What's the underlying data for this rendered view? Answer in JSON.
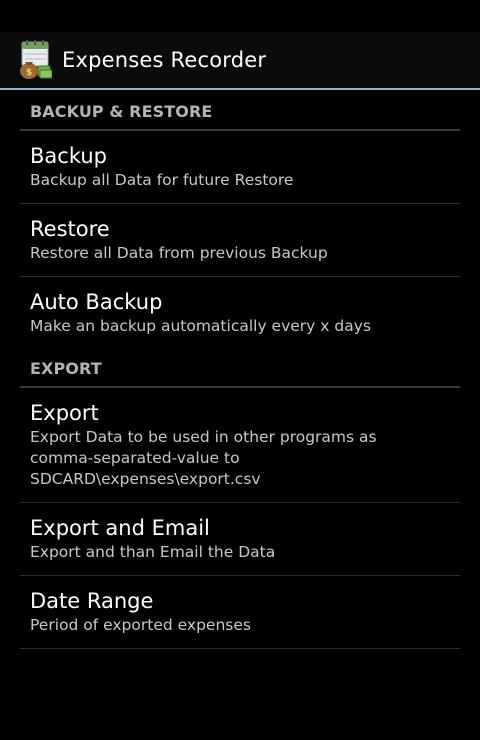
{
  "action_bar": {
    "title": "Expenses Recorder",
    "icon": "expenses-app-icon"
  },
  "sections": [
    {
      "header": "BACKUP & RESTORE",
      "items": [
        {
          "title": "Backup",
          "summary": "Backup all Data for future Restore"
        },
        {
          "title": "Restore",
          "summary": "Restore all Data from previous Backup"
        },
        {
          "title": "Auto Backup",
          "summary": "Make an backup automatically every x days"
        }
      ]
    },
    {
      "header": "EXPORT",
      "items": [
        {
          "title": "Export",
          "summary": "Export Data to be used in other programs as\ncomma-separated-value to\nSDCARD\\expenses\\export.csv"
        },
        {
          "title": "Export and Email",
          "summary": "Export and than Email the Data"
        },
        {
          "title": "Date Range",
          "summary": "Period of exported expenses"
        }
      ]
    }
  ],
  "colors": {
    "background": "#000000",
    "action_bar_divider": "#8fb5c8",
    "category_text": "#b4b4b4"
  }
}
